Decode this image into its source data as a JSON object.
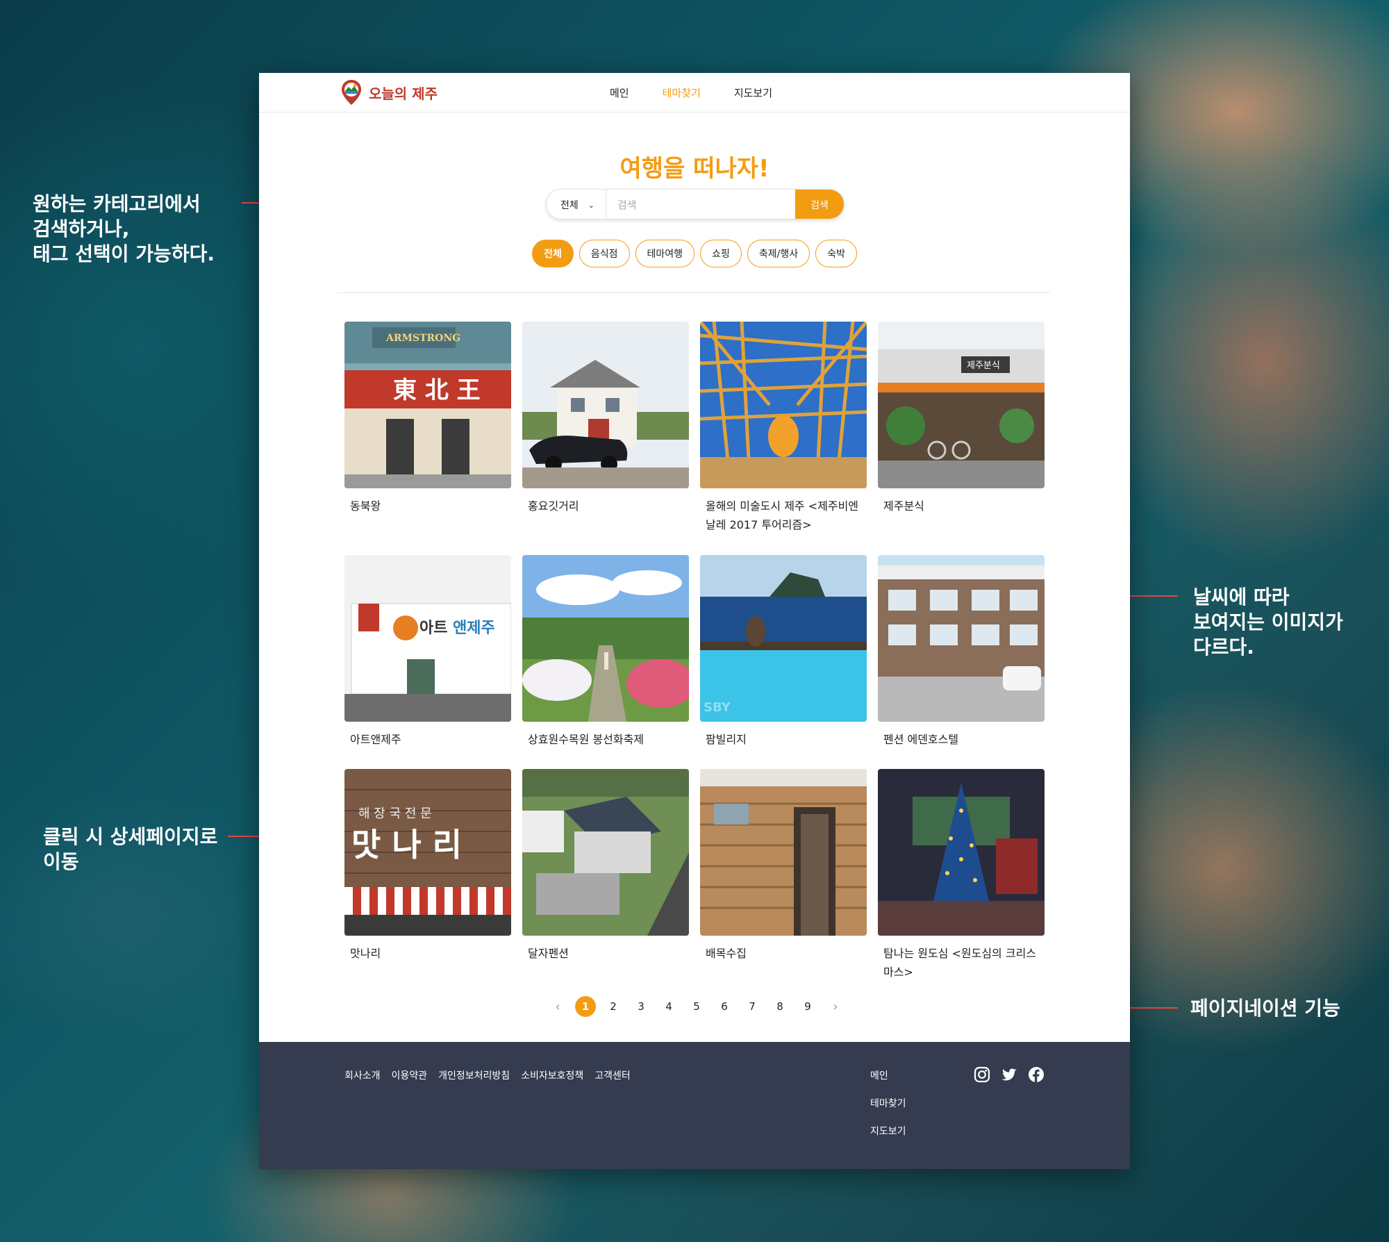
{
  "annotations": {
    "search": "원하는 카테고리에서\n검색하거나,\n태그 선택이 가능하다.",
    "weather": "날씨에 따라\n보여지는 이미지가\n다르다.",
    "detail": "클릭 시 상세페이지로\n이동",
    "pagination": "페이지네이션 기능"
  },
  "header": {
    "logo_text": "오늘의 제주",
    "nav": [
      "메인",
      "테마찾기",
      "지도보기"
    ],
    "active_nav": "테마찾기"
  },
  "hero": {
    "title": "여행을 떠나자!"
  },
  "search": {
    "category_value": "전체",
    "placeholder": "검색",
    "button_label": "검색"
  },
  "tags": [
    "전체",
    "음식점",
    "테마여행",
    "쇼핑",
    "축제/행사",
    "숙박"
  ],
  "active_tag": "전체",
  "cards": [
    {
      "title": "동북왕",
      "scene": "storefront-red"
    },
    {
      "title": "홍요깃거리",
      "scene": "house-car"
    },
    {
      "title": "올해의 미술도시 제주 <제주비엔날레 2017 투어리즘>",
      "scene": "bamboo-art"
    },
    {
      "title": "제주분식",
      "scene": "cafe-front"
    },
    {
      "title": "아트앤제주",
      "scene": "white-building"
    },
    {
      "title": "상효원수목원 봉선화축제",
      "scene": "flower-garden"
    },
    {
      "title": "팜빌리지",
      "scene": "pool-sea"
    },
    {
      "title": "펜션 에덴호스텔",
      "scene": "pension"
    },
    {
      "title": "맛나리",
      "scene": "wood-sign"
    },
    {
      "title": "달자펜션",
      "scene": "aerial-house"
    },
    {
      "title": "배목수집",
      "scene": "wood-cabin"
    },
    {
      "title": "탐나는 원도심 <원도심의 크리스마스>",
      "scene": "christmas-tree"
    }
  ],
  "pagination": {
    "pages": [
      "1",
      "2",
      "3",
      "4",
      "5",
      "6",
      "7",
      "8",
      "9"
    ],
    "current": "1",
    "prev": "‹",
    "next": "›"
  },
  "footer": {
    "links": [
      "회사소개",
      "이용약관",
      "개인정보처리방침",
      "소비자보호정책",
      "고객센터"
    ],
    "nav": [
      "메인",
      "테마찾기",
      "지도보기"
    ],
    "social": [
      "instagram-icon",
      "twitter-icon",
      "facebook-icon"
    ]
  },
  "colors": {
    "accent": "#f39c12",
    "footer_bg": "#353c50",
    "annotation_line": "#e8473c"
  }
}
